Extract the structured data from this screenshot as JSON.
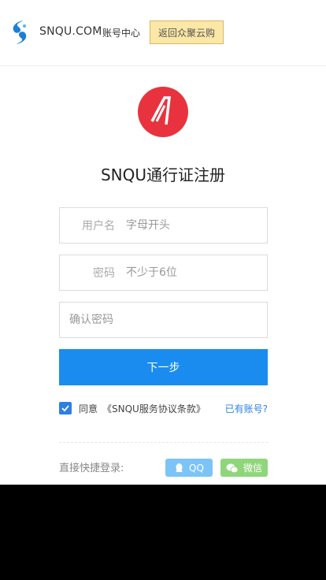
{
  "header": {
    "brand": "SNQU.COM",
    "subtitle": "账号中心",
    "back_button": "返回众聚云购"
  },
  "main": {
    "title": "SNQU通行证注册",
    "fields": [
      {
        "label": "用户名",
        "placeholder": "字母开头",
        "value": ""
      },
      {
        "label": "密码",
        "placeholder": "不少于6位",
        "value": ""
      },
      {
        "label": "",
        "placeholder": "确认密码",
        "value": ""
      }
    ],
    "next_button": "下一步",
    "agree_checked": true,
    "agree_text": "同意",
    "terms_link": "《SNQU服务协议条款》",
    "have_account_link": "已有账号?"
  },
  "quick_login": {
    "label": "直接快捷登录:",
    "qq": "QQ",
    "wechat": "微信"
  },
  "colors": {
    "primary": "#1a8cf0",
    "back_button_bg": "#fbe7a6",
    "qq_bg": "#7cc4f7",
    "wechat_bg": "#8fd67a",
    "logo_red": "#e8333f"
  }
}
